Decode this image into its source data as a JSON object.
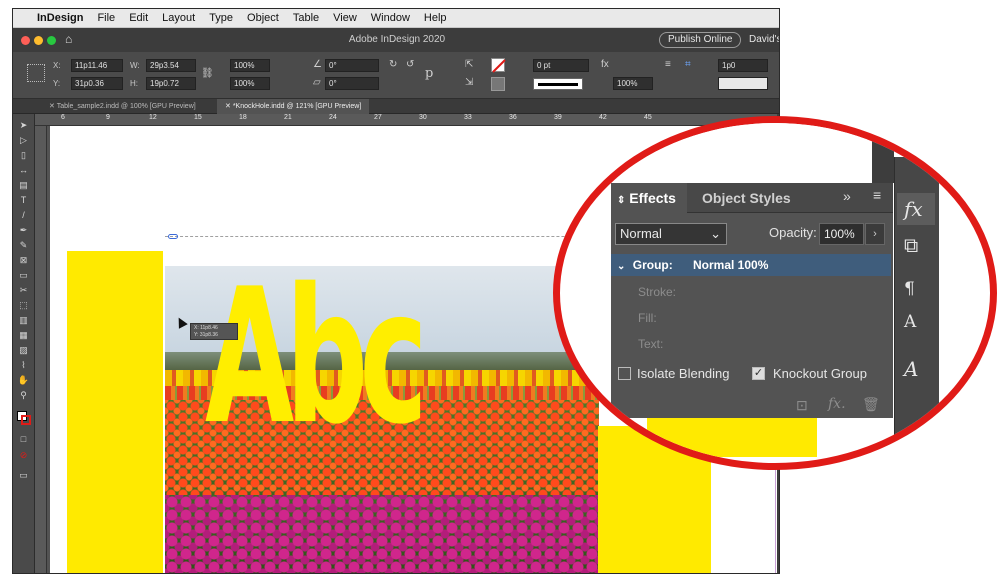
{
  "menubar": {
    "app": "InDesign",
    "items": [
      "File",
      "Edit",
      "Layout",
      "Type",
      "Object",
      "Table",
      "View",
      "Window",
      "Help"
    ]
  },
  "titlebar": {
    "title": "Adobe InDesign 2020",
    "publish": "Publish Online",
    "user": "David's"
  },
  "control": {
    "x": "11p11.46",
    "y": "31p0.36",
    "w": "29p3.54",
    "h": "19p0.72",
    "scale_x": "100%",
    "scale_y": "100%",
    "rotate": "0°",
    "shear": "0°",
    "stroke_weight": "0 pt",
    "opacity": "100%",
    "width_field": "1p0"
  },
  "tabs": [
    {
      "label": "Table_sample2.indd @ 100% [GPU Preview]"
    },
    {
      "label": "*KnockHole.indd @ 121% [GPU Preview]"
    }
  ],
  "ruler": {
    "ticks": [
      "6",
      "9",
      "12",
      "15",
      "18",
      "21",
      "24",
      "27",
      "30",
      "33",
      "36",
      "39",
      "42",
      "45"
    ]
  },
  "canvas": {
    "headline": "Abc",
    "tooltip_x": "X: 11p8.46",
    "tooltip_y": "Y: 31p8.36"
  },
  "effects_panel": {
    "tab_effects": "Effects",
    "tab_object_styles": "Object Styles",
    "blend_mode": "Normal",
    "opacity_label": "Opacity:",
    "opacity_value": "100%",
    "group_label": "Group:",
    "group_value": "Normal 100%",
    "stroke": "Stroke:",
    "fill": "Fill:",
    "text": "Text:",
    "isolate_blending": "Isolate Blending",
    "isolate_checked": false,
    "knockout_group": "Knockout Group",
    "knockout_checked": true
  },
  "colors": {
    "accent_red": "#e01b17",
    "yellow": "#ffea00",
    "panel_bg": "#535353",
    "selection_blue": "#3f5d7c"
  }
}
